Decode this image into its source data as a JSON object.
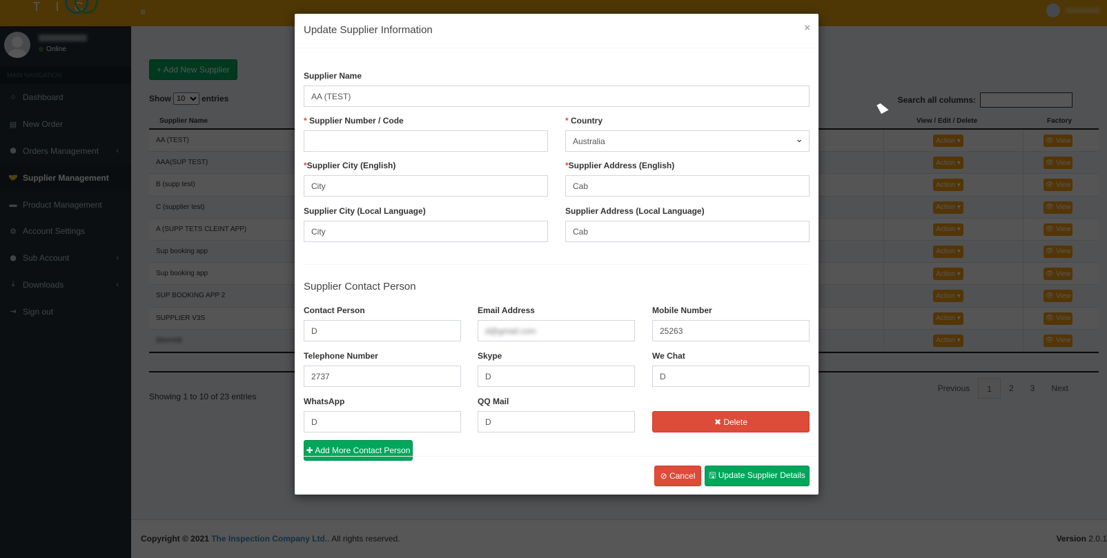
{
  "app": {
    "logo_text": "TIC",
    "user": {
      "status": "Online"
    }
  },
  "sidebar": {
    "header": "MAIN NAVIGATION",
    "items": [
      {
        "label": "Dashboard",
        "icon": "○",
        "chevron": ""
      },
      {
        "label": "New Order",
        "icon": "▤",
        "chevron": ""
      },
      {
        "label": "Orders Management",
        "icon": "⬢",
        "chevron": "‹"
      },
      {
        "label": "Supplier Management",
        "icon": "🤝",
        "chevron": ""
      },
      {
        "label": "Product Management",
        "icon": "▬",
        "chevron": ""
      },
      {
        "label": "Account Settings",
        "icon": "⚙",
        "chevron": ""
      },
      {
        "label": "Sub Account",
        "icon": "⬢",
        "chevron": "‹"
      },
      {
        "label": "Downloads",
        "icon": "⤓",
        "chevron": "‹"
      },
      {
        "label": "Sign out",
        "icon": "⇥",
        "chevron": ""
      }
    ]
  },
  "page": {
    "add_button": "+ Add New Supplier",
    "show_label": "Show",
    "show_value": "10",
    "entries_label": "entries",
    "search_label": "Search all columns:",
    "columns": {
      "name": "Supplier Name",
      "actions": "View / Edit / Delete",
      "factory": "Factory"
    },
    "action_label": "Action ▾",
    "view_label": "👁 View",
    "rows": [
      "AA (TEST)",
      "AAA(SUP TEST)",
      "B (supp test)",
      "C (supplier test)",
      "A (SUPP TETS CLEINT APP)",
      "Sup booking app",
      "Sup booking app",
      "SUP BOOKING APP 2",
      "SUPPLIER V3S",
      "(blurred)"
    ],
    "showing": "Showing 1 to 10 of 23 entries",
    "pager": {
      "previous": "Previous",
      "pages": [
        "1",
        "2",
        "3"
      ],
      "current": "1",
      "next": "Next"
    }
  },
  "footer": {
    "copy_prefix": "Copyright © 2021",
    "company": "The Inspection Company Ltd.",
    "copy_suffix": ". All rights reserved.",
    "version_label": "Version",
    "version": "2.0.1"
  },
  "modal": {
    "title": "Update Supplier Information",
    "close": "×",
    "fields": {
      "supplier_name": {
        "label": "Supplier Name",
        "value": "AA (TEST)"
      },
      "supplier_code": {
        "label": "Supplier Number / Code",
        "value": ""
      },
      "country": {
        "label": "Country",
        "value": "Australia"
      },
      "city_en": {
        "label": "Supplier City (English)",
        "value": "City"
      },
      "address_en": {
        "label": "Supplier Address (English)",
        "value": "Cab"
      },
      "city_local": {
        "label": "Supplier City (Local Language)",
        "value": "City"
      },
      "address_local": {
        "label": "Supplier Address (Local Language)",
        "value": "Cab"
      }
    },
    "contact_section_title": "Supplier Contact Person",
    "contact": {
      "contact_person": {
        "label": "Contact Person",
        "value": "D"
      },
      "email": {
        "label": "Email Address",
        "value": "d@gmail.com"
      },
      "mobile": {
        "label": "Mobile Number",
        "value": "25263"
      },
      "telephone": {
        "label": "Telephone Number",
        "value": "2737"
      },
      "skype": {
        "label": "Skype",
        "value": "D"
      },
      "wechat": {
        "label": "We Chat",
        "value": "D"
      },
      "whatsapp": {
        "label": "WhatsApp",
        "value": "D"
      },
      "qqmail": {
        "label": "QQ Mail",
        "value": "D"
      }
    },
    "required_mark": "*",
    "delete_button": "✖ Delete",
    "add_contact_button": "✚ Add More Contact Person",
    "cancel_button": "⊘ Cancel",
    "update_button": "🖫 Update Supplier Details"
  },
  "colors": {
    "brand": "#e59e10",
    "sidebar": "#222d32",
    "success": "#00a65a",
    "danger": "#dd4b39",
    "warning": "#f39c12"
  }
}
